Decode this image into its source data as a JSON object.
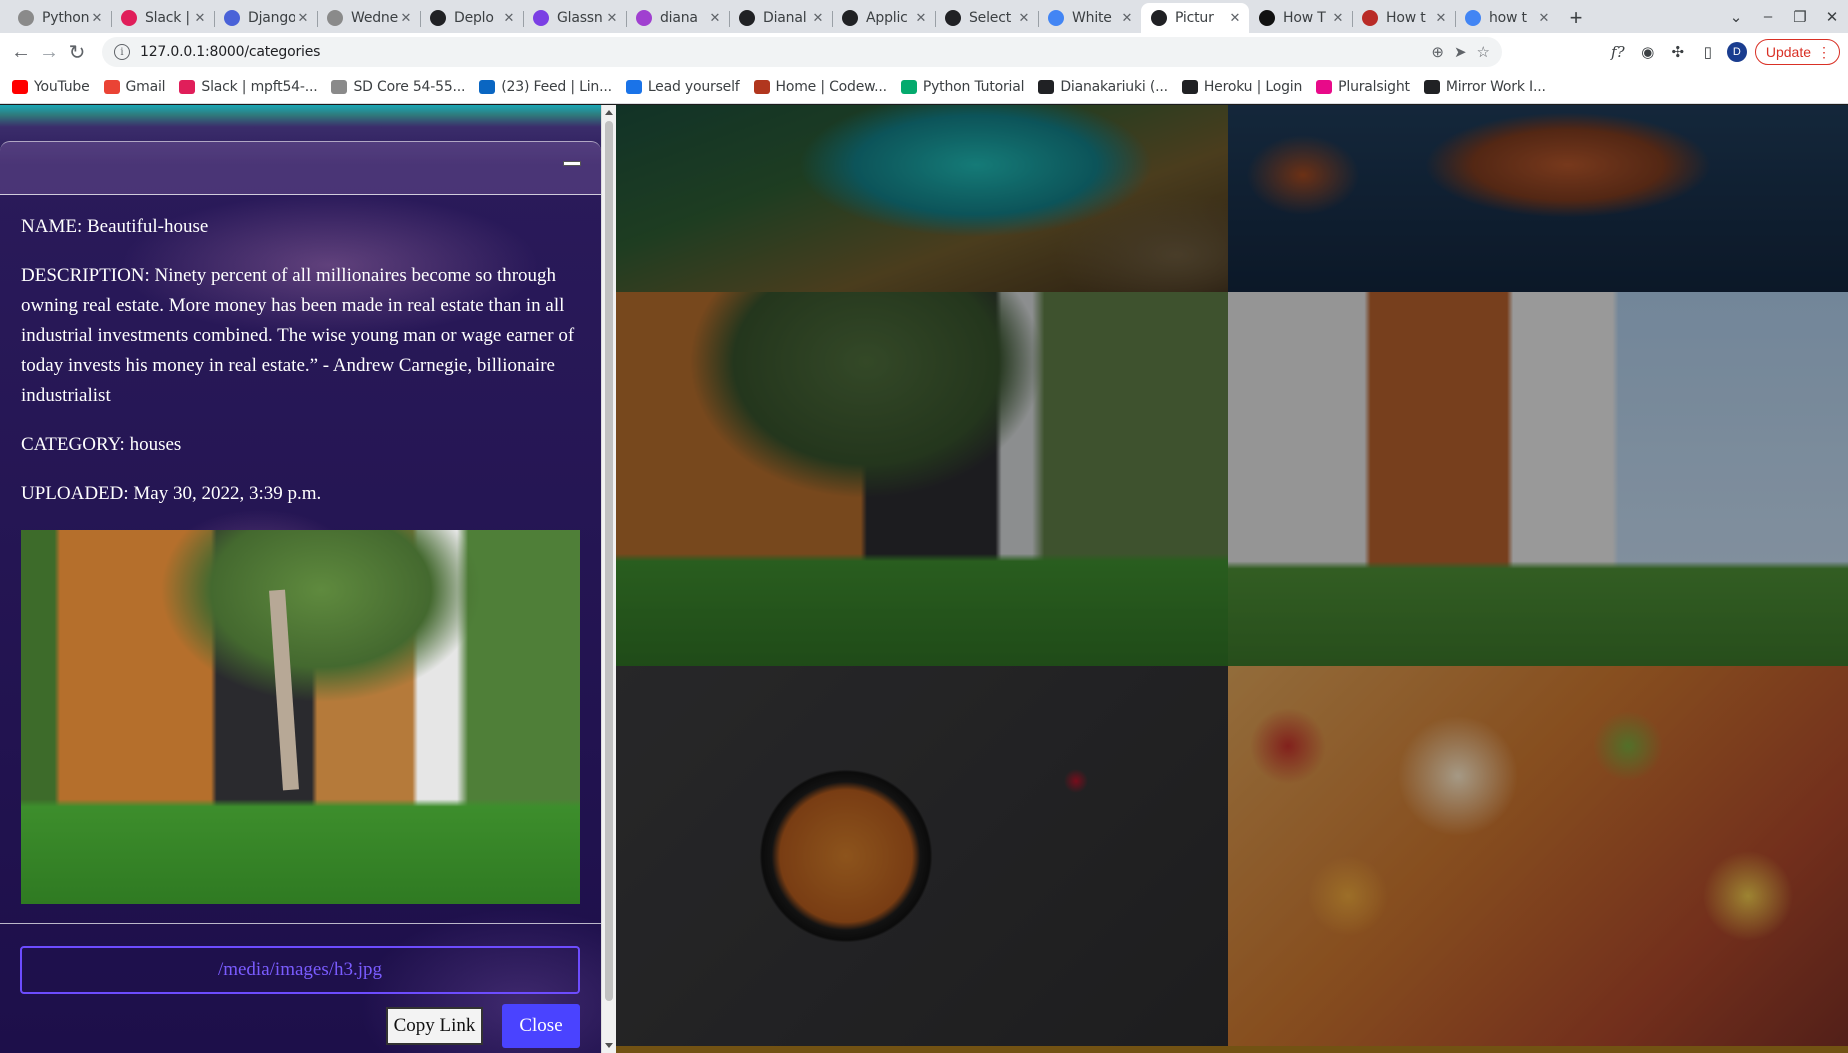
{
  "browser": {
    "tabs": [
      {
        "title": "Python",
        "favicon": "python-icon",
        "color": "#8a8a8a"
      },
      {
        "title": "Slack | ",
        "favicon": "slack-icon",
        "color": "#e01e5a"
      },
      {
        "title": "Django",
        "favicon": "doc-icon",
        "color": "#4a62d8"
      },
      {
        "title": "Wedne",
        "favicon": "python-icon",
        "color": "#8a8a8a"
      },
      {
        "title": "Deplo",
        "favicon": "github-icon",
        "color": "#202124"
      },
      {
        "title": "Glassn",
        "favicon": "glassnode-icon",
        "color": "#7b3fe4"
      },
      {
        "title": "diana",
        "favicon": "hashnode-icon",
        "color": "#a040d0"
      },
      {
        "title": "Dianal",
        "favicon": "github-icon",
        "color": "#202124"
      },
      {
        "title": "Applic",
        "favicon": "globe-icon",
        "color": "#202124"
      },
      {
        "title": "Select",
        "favicon": "globe-icon",
        "color": "#202124"
      },
      {
        "title": "White",
        "favicon": "google-icon",
        "color": "#4285f4"
      },
      {
        "title": "Pictur",
        "favicon": "globe-icon",
        "color": "#202124",
        "active": true
      },
      {
        "title": "How T",
        "favicon": "dev-icon",
        "color": "#111111"
      },
      {
        "title": "How t",
        "favicon": "quora-icon",
        "color": "#b92b27"
      },
      {
        "title": "how t",
        "favicon": "google-icon",
        "color": "#4285f4"
      }
    ],
    "new_tab_label": "+",
    "address": "127.0.0.1:8000/categories",
    "update_label": "Update",
    "profile_initial": "D",
    "bookmarks": [
      {
        "label": "YouTube",
        "icon": "youtube-icon",
        "color": "#ff0000"
      },
      {
        "label": "Gmail",
        "icon": "gmail-icon",
        "color": "#ea4335"
      },
      {
        "label": "Slack | mpft54-...",
        "icon": "slack-icon",
        "color": "#e01e5a"
      },
      {
        "label": "SD Core 54-55...",
        "icon": "python-icon",
        "color": "#8a8a8a"
      },
      {
        "label": "(23) Feed | Lin...",
        "icon": "linkedin-icon",
        "color": "#0a66c2"
      },
      {
        "label": "Lead yourself",
        "icon": "video-icon",
        "color": "#1a73e8"
      },
      {
        "label": "Home | Codew...",
        "icon": "codewars-icon",
        "color": "#b1361e"
      },
      {
        "label": "Python Tutorial",
        "icon": "w3-icon",
        "color": "#04aa6d"
      },
      {
        "label": "Dianakariuki (...",
        "icon": "github-icon",
        "color": "#202124"
      },
      {
        "label": "Heroku | Login",
        "icon": "globe-icon",
        "color": "#202124"
      },
      {
        "label": "Pluralsight",
        "icon": "pluralsight-icon",
        "color": "#e80a89"
      },
      {
        "label": "Mirror Work I...",
        "icon": "globe-icon",
        "color": "#202124"
      }
    ]
  },
  "modal": {
    "name_line": "NAME: Beautiful-house",
    "description_line": "DESCRIPTION: Ninety percent of all millionaires become so through owning real estate. More money has been made in real estate than in all industrial investments combined. The wise young man or wage earner of today invests his money in real estate.” - Andrew Carnegie, billionaire industrialist",
    "category_line": "CATEGORY: houses",
    "uploaded_line": "UPLOADED: May 30, 2022, 3:39 p.m.",
    "image_path": "/media/images/h3.jpg",
    "copy_label": "Copy Link",
    "close_label": "Close",
    "accent": "#4a43ff"
  },
  "gallery": {
    "tiles": [
      "coast",
      "sea-turtle",
      "modern-house",
      "modern-house",
      "paella",
      "food-spread"
    ]
  }
}
